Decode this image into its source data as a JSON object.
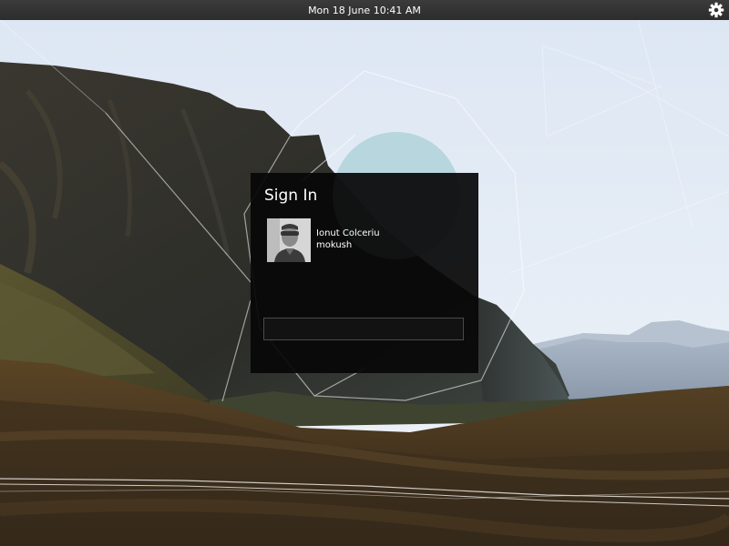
{
  "top_panel": {
    "clock": "Mon 18 June 10:41 AM",
    "settings_icon": "gear-icon"
  },
  "signin": {
    "title": "Sign In",
    "user": {
      "full_name": "Ionut Colceriu",
      "username": "mokush"
    },
    "password_value": ""
  }
}
